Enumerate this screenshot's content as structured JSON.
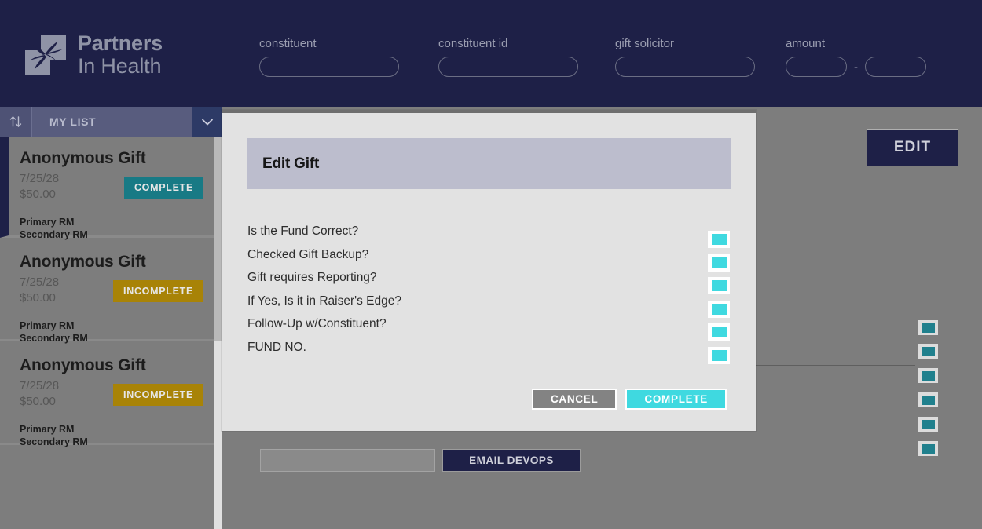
{
  "app": {
    "brand_line1": "Partners",
    "brand_line2": "In Health",
    "brand_color": "#1e2047",
    "accent_cyan": "#3fd9e0",
    "accent_teal": "#187a85",
    "accent_gold": "#a88307"
  },
  "header": {
    "fields": [
      {
        "label": "constituent",
        "value": "",
        "placeholder": ""
      },
      {
        "label": "constituent id",
        "value": "",
        "placeholder": ""
      },
      {
        "label": "gift solicitor",
        "value": "",
        "placeholder": ""
      }
    ],
    "amount": {
      "label": "amount",
      "min_value": "",
      "max_value": "",
      "separator": "-"
    }
  },
  "sidebar": {
    "sort_icon": "sort-up-down-icon",
    "list_label": "MY LIST",
    "dropdown_icon": "chevron-down-icon",
    "items": [
      {
        "title": "Anonymous Gift",
        "date": "7/25/28",
        "amount": "$50.00",
        "status": "COMPLETE",
        "status_kind": "complete",
        "primary_rm": "Primary RM",
        "secondary_rm": "Secondary RM",
        "selected": true
      },
      {
        "title": "Anonymous Gift",
        "date": "7/25/28",
        "amount": "$50.00",
        "status": "INCOMPLETE",
        "status_kind": "incomplete",
        "primary_rm": "Primary RM",
        "secondary_rm": "Secondary RM",
        "selected": false
      },
      {
        "title": "Anonymous Gift",
        "date": "7/25/28",
        "amount": "$50.00",
        "status": "INCOMPLETE",
        "status_kind": "incomplete",
        "primary_rm": "Primary RM",
        "secondary_rm": "Secondary RM",
        "selected": false
      }
    ]
  },
  "main": {
    "edit_label": "EDIT",
    "devops_input_value": "",
    "devops_button_label": "EMAIL DEVOPS",
    "background_checkbox_count": 6
  },
  "modal": {
    "title": "Edit Gift",
    "questions": [
      {
        "label": "Is the Fund Correct?",
        "checked": true
      },
      {
        "label": "Checked Gift Backup?",
        "checked": true
      },
      {
        "label": "Gift requires Reporting?",
        "checked": true
      },
      {
        "label": "If Yes, Is it in Raiser's Edge?",
        "checked": true
      },
      {
        "label": "Follow-Up w/Constituent?",
        "checked": true
      },
      {
        "label": "FUND NO.",
        "checked": true
      }
    ],
    "cancel_label": "CANCEL",
    "complete_label": "COMPLETE"
  }
}
